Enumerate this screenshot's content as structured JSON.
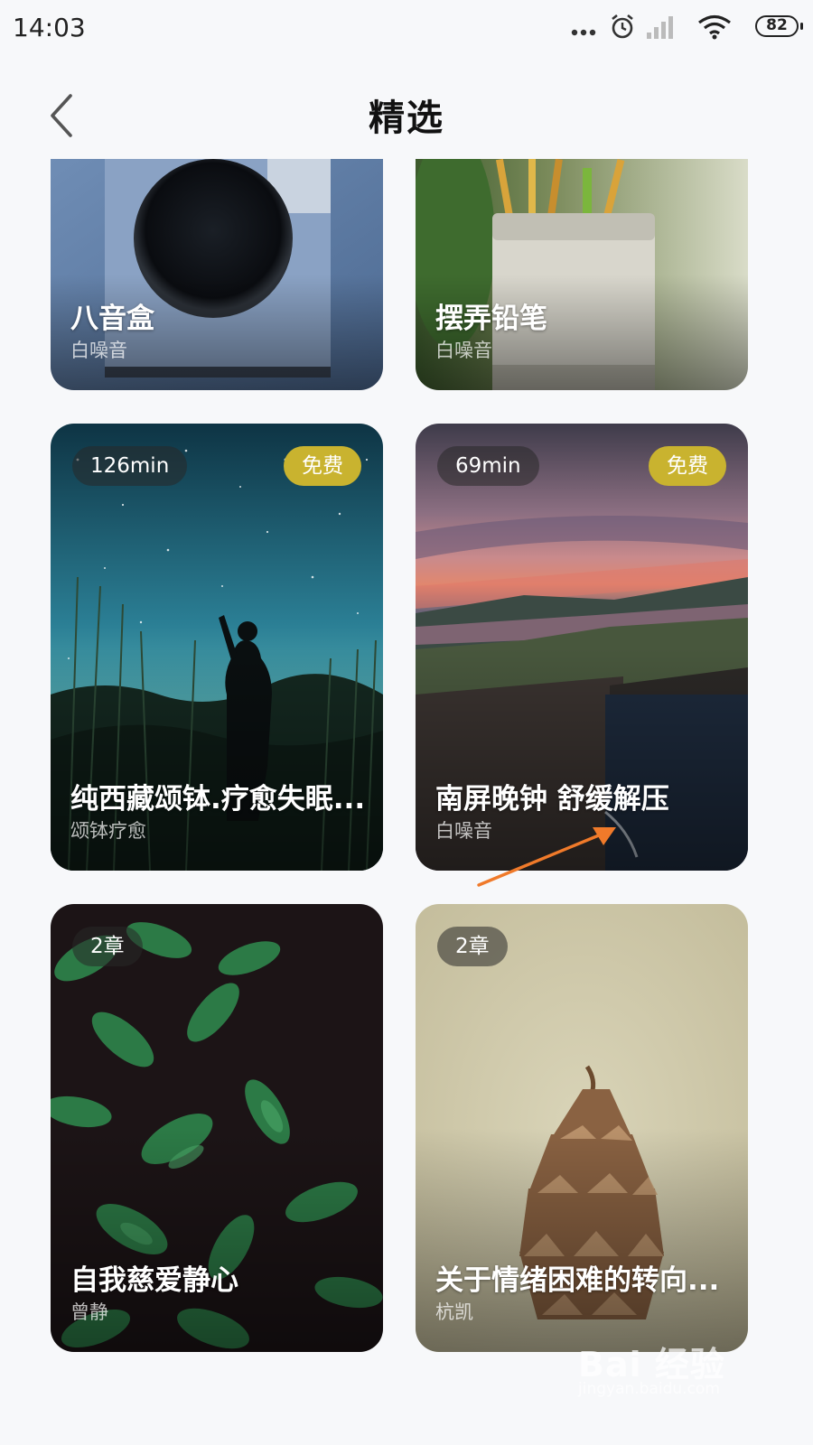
{
  "status": {
    "time": "14:03",
    "battery": "82",
    "icons": [
      "more-dots-icon",
      "alarm-icon",
      "signal-icon",
      "wifi-icon",
      "battery-icon"
    ]
  },
  "header": {
    "title": "精选",
    "back_icon": "chevron-left-icon"
  },
  "cards": [
    {
      "title": "八音盒",
      "subtitle": "白噪音"
    },
    {
      "title": "摆弄铅笔",
      "subtitle": "白噪音"
    },
    {
      "title": "纯西藏颂钵.疗愈失眠...",
      "subtitle": "颂钵疗愈",
      "duration": "126min",
      "badge": "免费"
    },
    {
      "title": "南屏晚钟 舒缓解压",
      "subtitle": "白噪音",
      "duration": "69min",
      "badge": "免费"
    },
    {
      "title": "自我慈爱静心",
      "subtitle": "曾静",
      "duration": "2章"
    },
    {
      "title": "关于情绪困难的转向...",
      "subtitle": "杭凯",
      "duration": "2章"
    }
  ],
  "watermark": {
    "logo": "Bai 经验",
    "url": "jingyan.baidu.com"
  },
  "colors": {
    "badge": "#c9b32f",
    "annotation_arrow": "#f07a2a"
  }
}
